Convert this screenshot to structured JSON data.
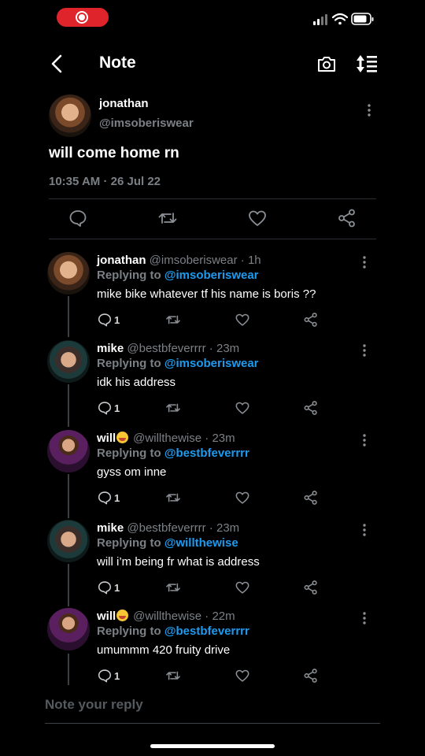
{
  "status_bar": {
    "icons": [
      "screen-record-icon",
      "cellular-signal-icon",
      "wifi-icon",
      "battery-icon"
    ]
  },
  "header": {
    "title": "Note",
    "icons": [
      "back-arrow-icon",
      "camera-icon",
      "sort-icon"
    ]
  },
  "original_post": {
    "name": "jonathan",
    "handle": "@imsoberiswear",
    "text": "will come home rn",
    "timestamp": "10:35 AM · 26 Jul 22",
    "actions": [
      "reply-icon",
      "repost-icon",
      "like-icon",
      "share-icon"
    ]
  },
  "replies": [
    {
      "name": "jonathan",
      "emoji": false,
      "handle": "@imsoberiswear",
      "time": "1h",
      "replying_to_label": "Replying to",
      "replying_to": "@imsoberiswear",
      "text": "mike bike whatever tf his name is  boris ??",
      "reply_count": "1",
      "avatar": "jonathan"
    },
    {
      "name": "mike",
      "emoji": false,
      "handle": "@bestbfeverrrr",
      "time": "23m",
      "replying_to_label": "Replying to",
      "replying_to": "@imsoberiswear",
      "text": "idk his address",
      "reply_count": "1",
      "avatar": "mike"
    },
    {
      "name": "will",
      "emoji": true,
      "handle": "@willthewise",
      "time": "23m",
      "replying_to_label": "Replying to",
      "replying_to": "@bestbfeverrrr",
      "text": "gyss om inne",
      "reply_count": "1",
      "avatar": "will"
    },
    {
      "name": "mike",
      "emoji": false,
      "handle": "@bestbfeverrrr",
      "time": "23m",
      "replying_to_label": "Replying to",
      "replying_to": "@willthewise",
      "text": "will i’m being fr what is address",
      "reply_count": "1",
      "avatar": "mike"
    },
    {
      "name": "will",
      "emoji": true,
      "handle": "@willthewise",
      "time": "22m",
      "replying_to_label": "Replying to",
      "replying_to": "@bestbfeverrrr",
      "text": "umummm 420 fruity drive",
      "reply_count": "1",
      "avatar": "will"
    }
  ],
  "compose": {
    "placeholder": "Note your reply"
  },
  "colors": {
    "background": "#000000",
    "accent": "#1d9bf0",
    "muted": "#7b8085",
    "recording": "#e0242b"
  }
}
